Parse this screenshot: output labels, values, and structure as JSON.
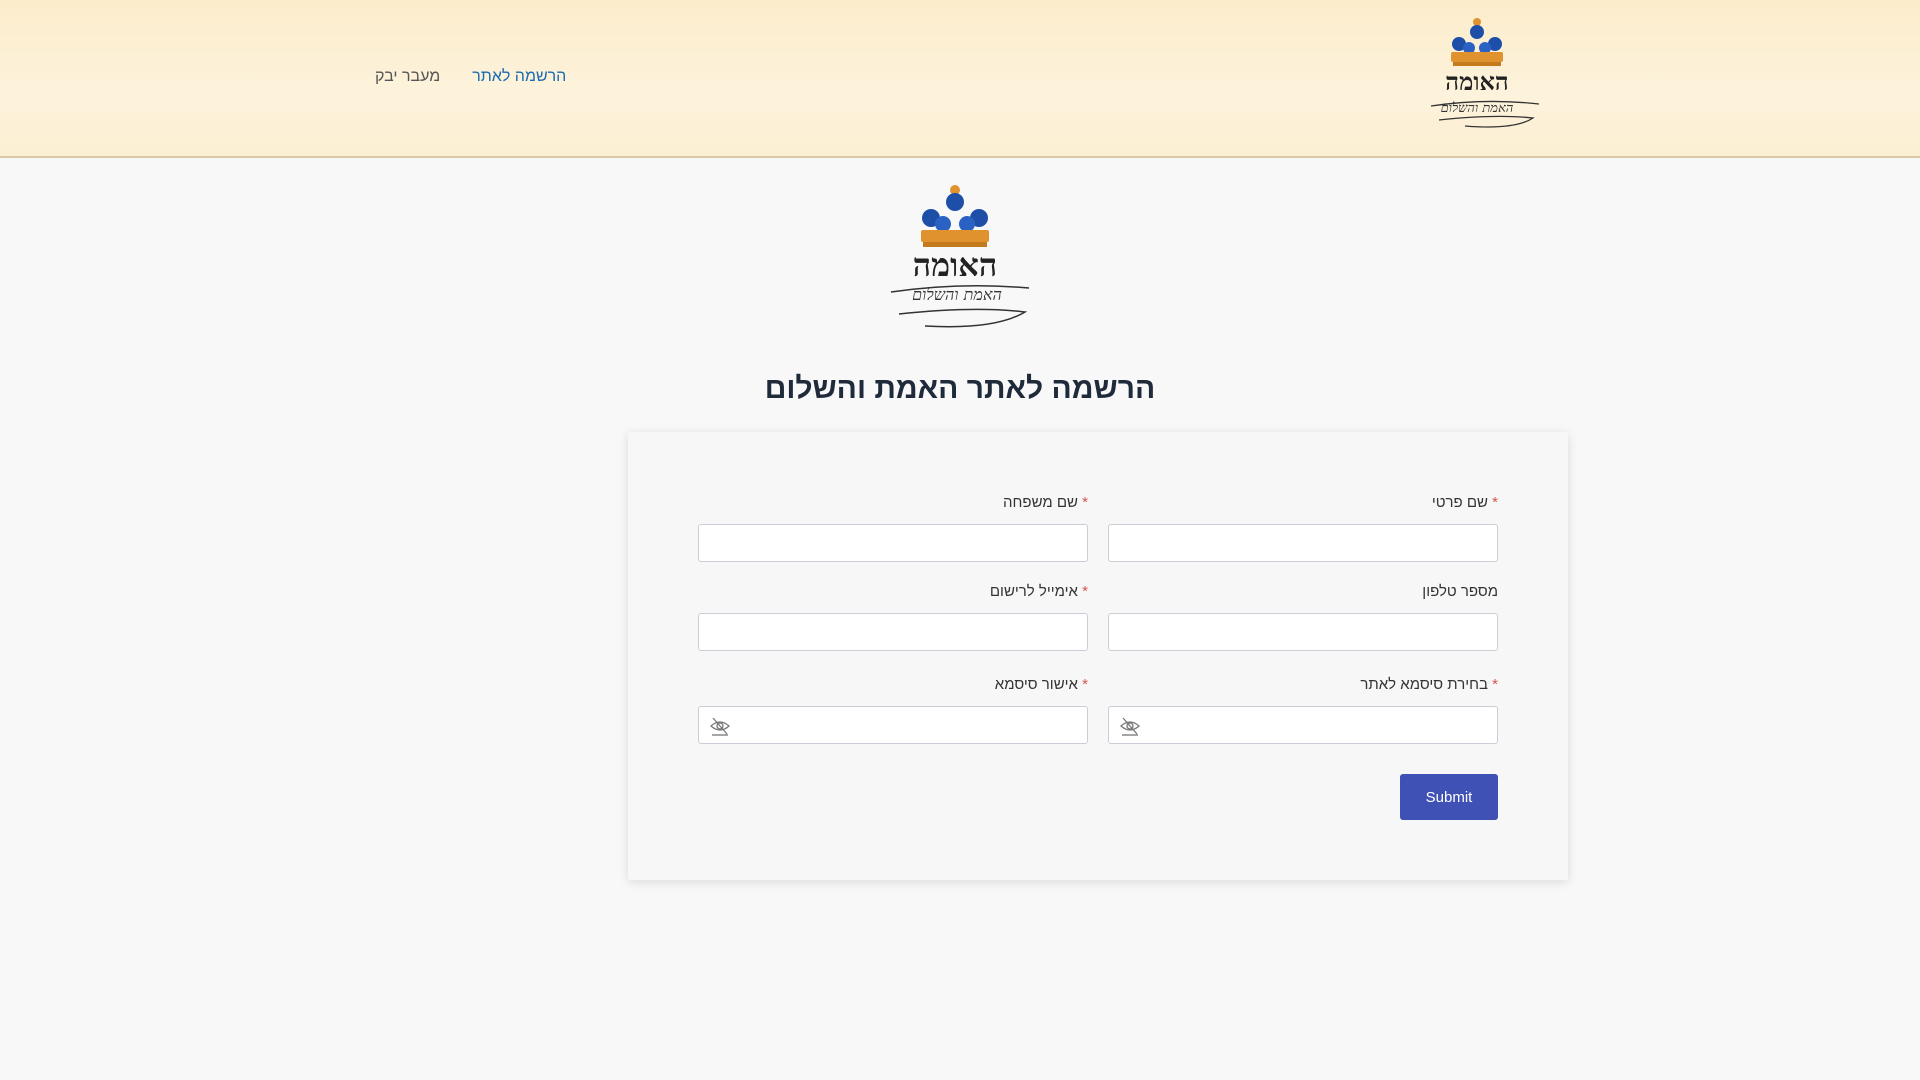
{
  "header": {
    "nav": [
      {
        "label": "הרשמה לאתר",
        "active": true
      },
      {
        "label": "מעבר יבק",
        "active": false
      }
    ],
    "logo_text": "האומה",
    "logo_subtext": "האמת והשלום"
  },
  "page": {
    "title": "הרשמה לאתר האמת והשלום"
  },
  "form": {
    "first_name_label": "שם פרטי",
    "last_name_label": "שם משפחה",
    "phone_label": "מספר טלפון",
    "email_label": "אימייל לרישום",
    "password_label": "בחירת סיסמא לאתר",
    "confirm_password_label": "אישור סיסמא",
    "required_mark": "*",
    "submit_label": "Submit"
  },
  "colors": {
    "accent": "#3f51b5",
    "link": "#1a6bb0",
    "required": "#d9534f",
    "header_bg": "#fdf3dc"
  },
  "icons": {
    "password_toggle": "eye-slash-icon"
  }
}
